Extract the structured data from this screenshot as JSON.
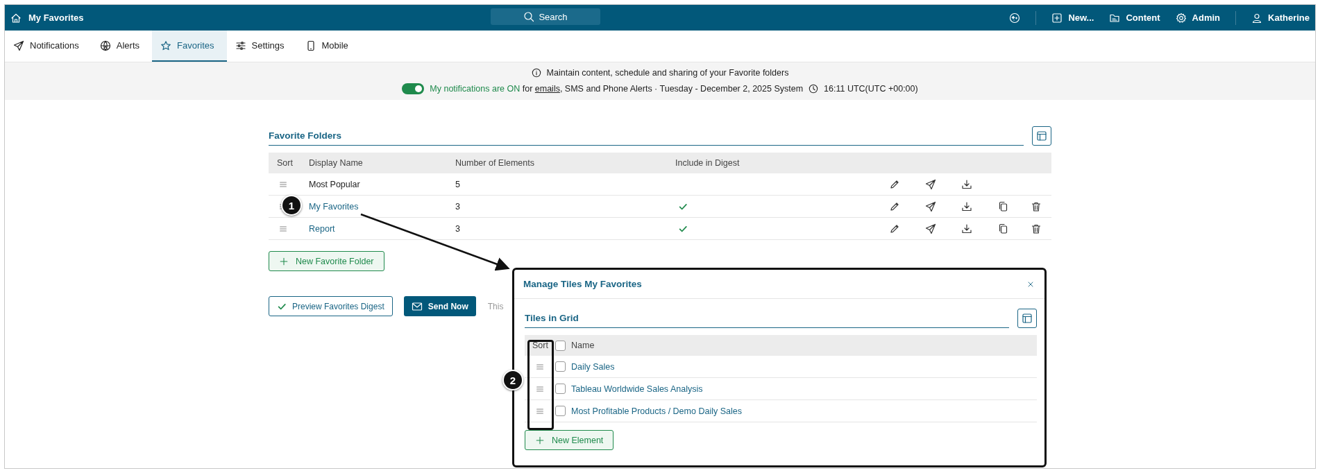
{
  "top_bar": {
    "title": "My Favorites",
    "search": "Search",
    "menu": [
      {
        "kind": "new",
        "label": "New..."
      },
      {
        "kind": "content",
        "label": "Content"
      },
      {
        "kind": "admin",
        "label": "Admin"
      },
      {
        "kind": "user",
        "label": "Katherine"
      }
    ]
  },
  "tabs": [
    {
      "kind": "notifications",
      "label": "Notifications",
      "selected": false
    },
    {
      "kind": "alerts",
      "label": "Alerts",
      "selected": false
    },
    {
      "kind": "favorites",
      "label": "Favorites",
      "selected": true
    },
    {
      "kind": "settings",
      "label": "Settings",
      "selected": false
    },
    {
      "kind": "mobile",
      "label": "Mobile",
      "selected": false
    }
  ],
  "info": {
    "message": "Maintain content, schedule and sharing of your Favorite folders",
    "notifications_on": true,
    "status": "My notifications are ON",
    "status_for": "for",
    "link": "emails",
    "status_rest": ", SMS and Phone Alerts · Tuesday - December 2, 2025 System",
    "time": "16:11 UTC(UTC +00:00)"
  },
  "favorite_folders": {
    "title": "Favorite Folders",
    "columns": [
      "Sort",
      "Display Name",
      "Number of Elements",
      "Include in Digest"
    ],
    "rows": [
      {
        "name": "Most Popular",
        "link": false,
        "count": "5",
        "included": false,
        "can_copy": false,
        "can_delete": false
      },
      {
        "name": "My Favorites",
        "link": true,
        "count": "3",
        "included": true,
        "can_copy": true,
        "can_delete": true
      },
      {
        "name": "Report",
        "link": true,
        "count": "3",
        "included": true,
        "can_copy": true,
        "can_delete": true
      }
    ],
    "new_button": "New Favorite Folder"
  },
  "digest": {
    "preview_button": "Preview Favorites Digest",
    "send_button": "Send Now",
    "note": "This"
  },
  "modal": {
    "title": "Manage Tiles My Favorites",
    "section": "Tiles in Grid",
    "columns": [
      "Sort",
      "Name"
    ],
    "all_checked": false,
    "rows": [
      {
        "name": "Daily Sales",
        "checked": false
      },
      {
        "name": "Tableau Worldwide Sales Analysis",
        "checked": false
      },
      {
        "name": "Most Profitable Products / Demo Daily Sales",
        "checked": false
      }
    ],
    "new_button": "New Element"
  },
  "callouts": [
    {
      "label": "1"
    },
    {
      "label": "2"
    }
  ]
}
